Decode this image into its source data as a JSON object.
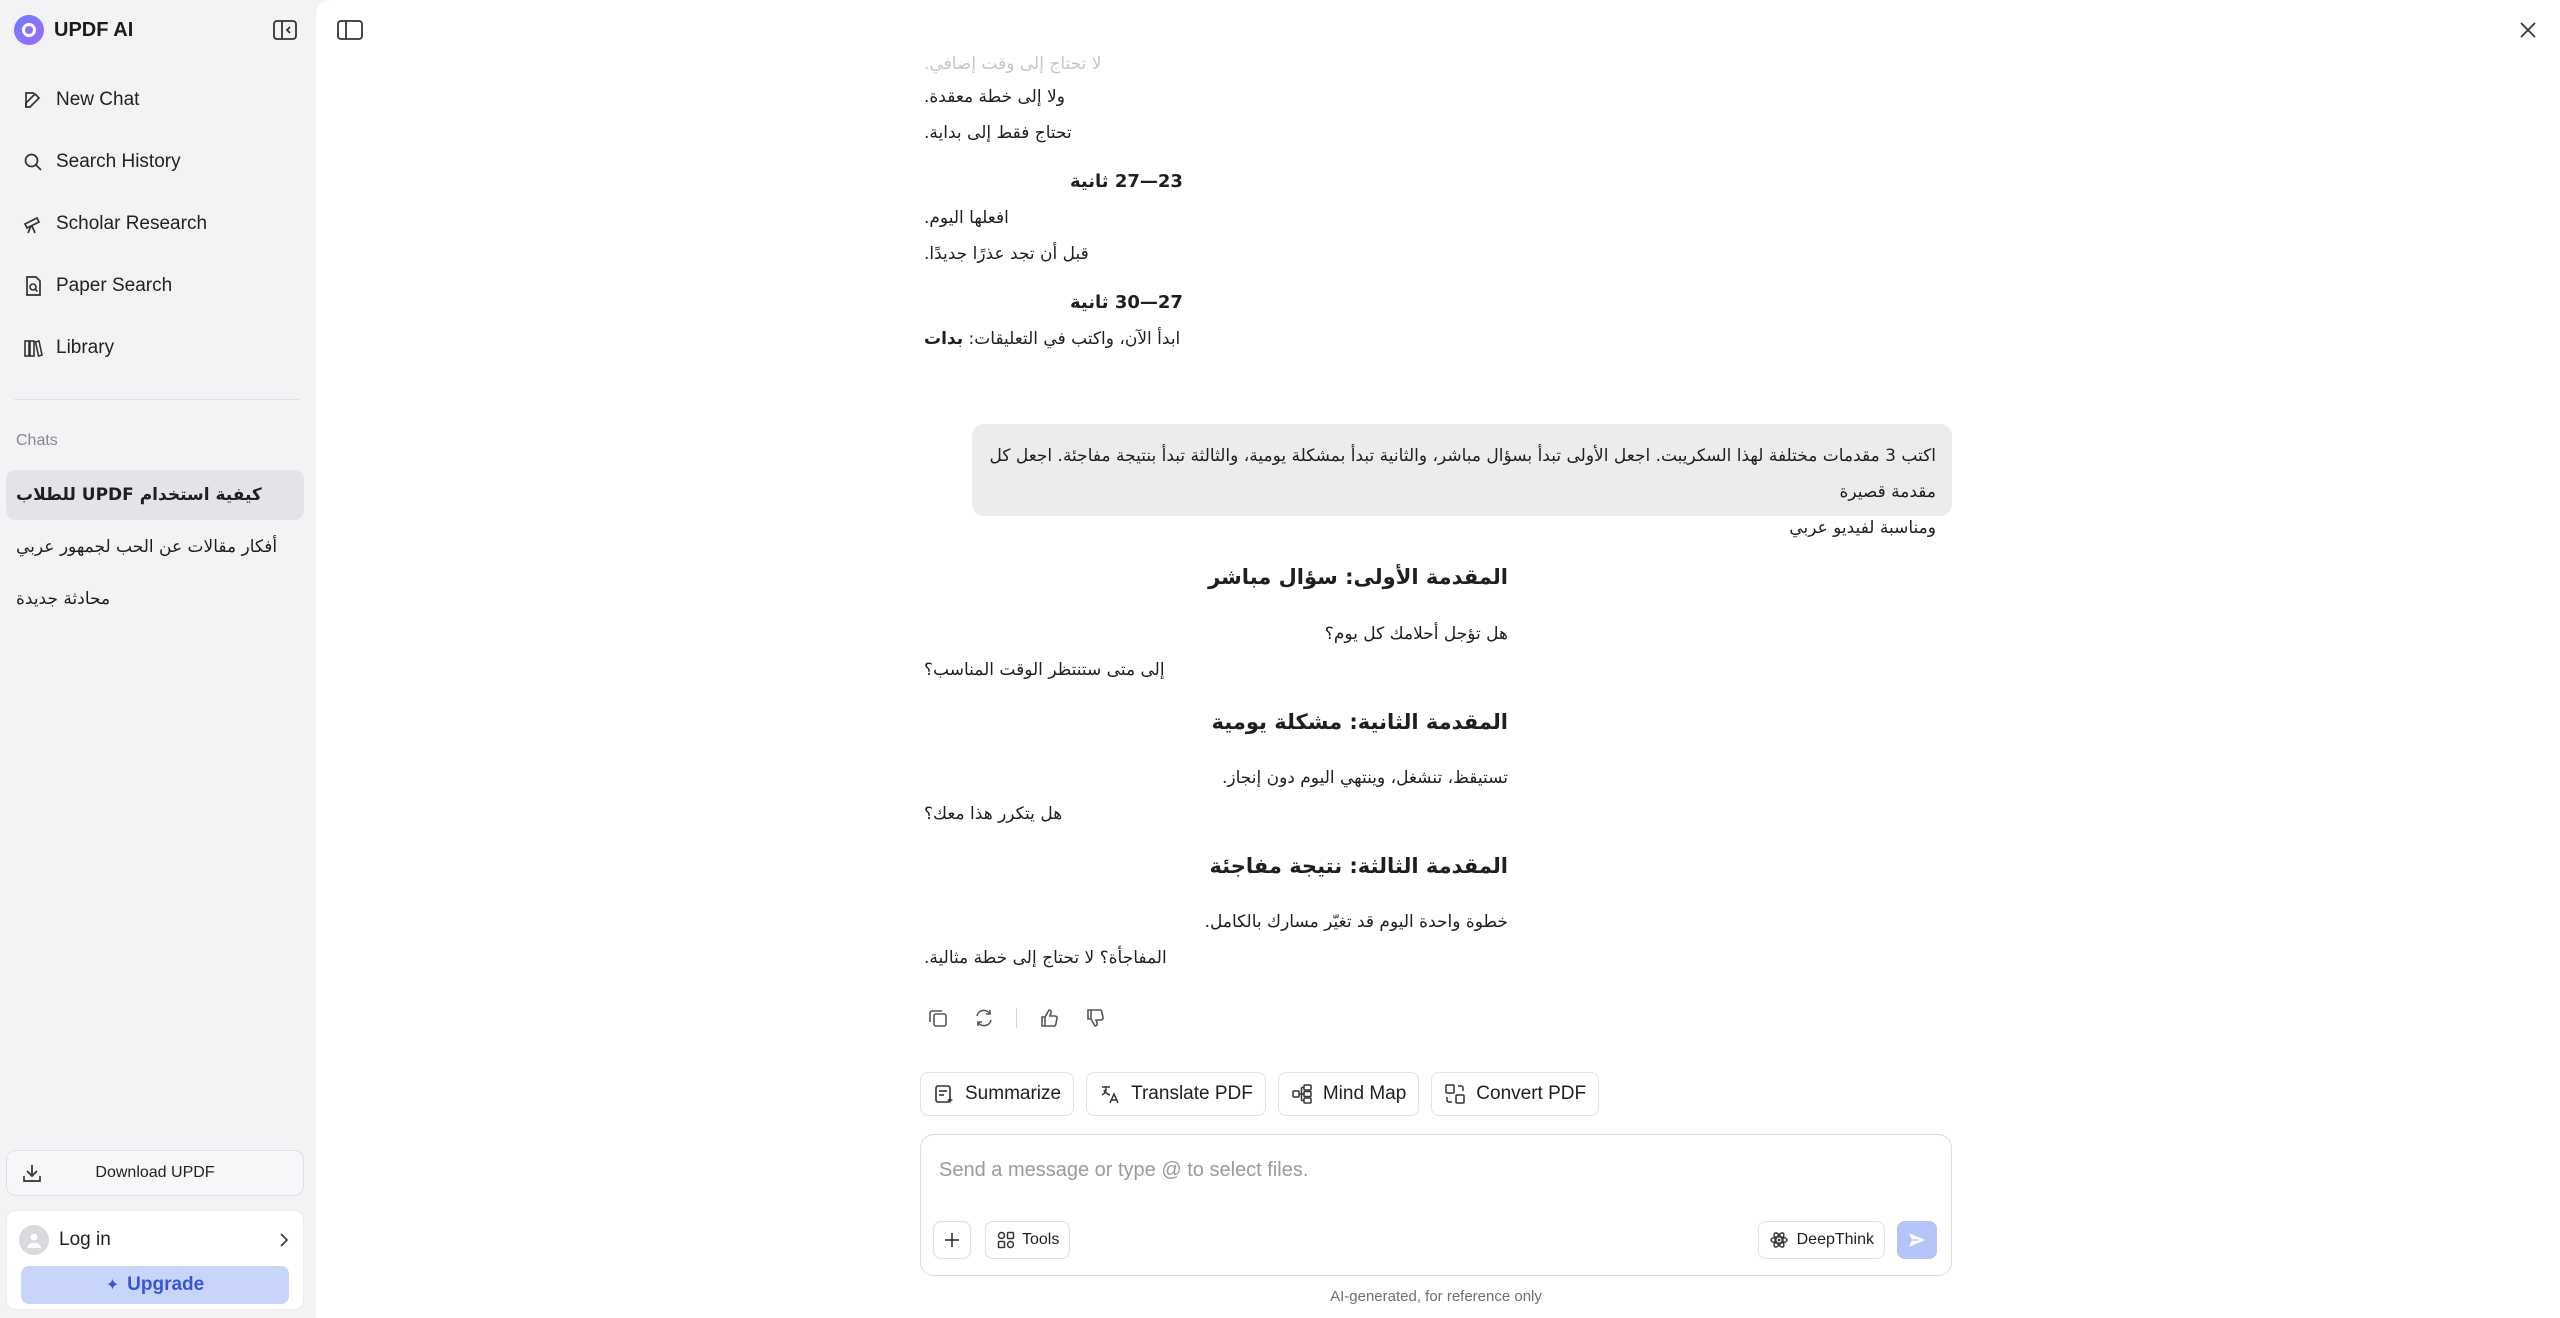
{
  "app": {
    "brand": "UPDF AI"
  },
  "sidebar": {
    "nav": [
      {
        "label": "New Chat",
        "icon": "edit-icon"
      },
      {
        "label": "Search History",
        "icon": "search-icon"
      },
      {
        "label": "Scholar Research",
        "icon": "telescope-icon"
      },
      {
        "label": "Paper Search",
        "icon": "document-search-icon"
      },
      {
        "label": "Library",
        "icon": "library-icon"
      }
    ],
    "chats_heading": "Chats",
    "chats": [
      {
        "label": "كيفية استخدام UPDF للطلاب",
        "active": true
      },
      {
        "label": "أفكار مقالات عن الحب لجمهور عربي",
        "active": false
      },
      {
        "label": "محادثة جديدة",
        "active": false
      }
    ],
    "download_label": "Download UPDF",
    "login_label": "Log in",
    "upgrade_label": "Upgrade"
  },
  "conversation": {
    "faded_line": "لا تحتاج إلى وقت إضافي.",
    "prev_lines": [
      "ولا إلى خطة معقدة.",
      "تحتاج فقط إلى بداية."
    ],
    "section_23_27": "23—27 ثانية",
    "lines_23_27": [
      "افعلها اليوم.",
      "قبل أن تجد عذرًا جديدًا."
    ],
    "section_27_30": "27—30 ثانية",
    "cta_line_prefix": "ابدأ الآن، واكتب في التعليقات: ",
    "cta_line_bold": "بدات",
    "user_message_line1": "اكتب 3 مقدمات مختلفة لهذا السكريبت. اجعل الأولى تبدأ بسؤال مباشر، والثانية تبدأ بمشكلة يومية، والثالثة تبدأ بنتيجة مفاجئة. اجعل كل مقدمة قصيرة",
    "user_message_line2": "ومناسبة لفيديو عربي",
    "intro1_heading": "المقدمة الأولى: سؤال مباشر",
    "intro1_lines": [
      "هل تؤجل أحلامك كل يوم؟",
      "إلى متى ستنتظر الوقت المناسب؟"
    ],
    "intro2_heading": "المقدمة الثانية: مشكلة يومية",
    "intro2_lines": [
      "تستيقظ، تنشغل، وينتهي اليوم دون إنجاز.",
      "هل يتكرر هذا معك؟"
    ],
    "intro3_heading": "المقدمة الثالثة: نتيجة مفاجئة",
    "intro3_lines": [
      "خطوة واحدة اليوم قد تغيّر مسارك بالكامل.",
      "المفاجأة؟ لا تحتاج إلى خطة مثالية."
    ]
  },
  "quick_actions": [
    {
      "label": "Summarize",
      "icon": "summarize-icon"
    },
    {
      "label": "Translate PDF",
      "icon": "translate-icon"
    },
    {
      "label": "Mind Map",
      "icon": "mind-map-icon"
    },
    {
      "label": "Convert PDF",
      "icon": "convert-icon"
    }
  ],
  "composer": {
    "placeholder": "Send a message or type @ to select files.",
    "value": "",
    "tools_label": "Tools",
    "deepthink_label": "DeepThink"
  },
  "disclaimer": "AI-generated, for reference only",
  "colors": {
    "accent": "#3a56d4",
    "upgrade_bg": "#c9d4fb",
    "send_bg": "#b6c3f7",
    "active_chat_bg": "#e4e4e8"
  }
}
